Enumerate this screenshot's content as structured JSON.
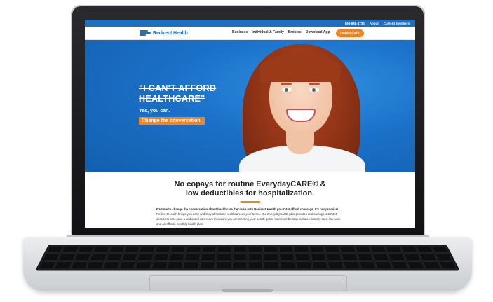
{
  "topbar": {
    "phone": "866-698-4734",
    "about": "About",
    "current_members": "Current Members"
  },
  "nav": {
    "logo_text": "Redirect Health",
    "items": [
      "Business",
      "Individual & Family",
      "Brokers",
      "Download App"
    ],
    "cta": "I Need Care"
  },
  "hero": {
    "headline_line1": "\"I CAN'T AFFORD",
    "headline_line2": "HEALTHCARE\"",
    "subline": "Yes, you can.",
    "cta": "Change the conversation."
  },
  "content": {
    "title_line1": "No copays for routine EverydayCARE® &",
    "title_line2": "low deductibles for hospitalization.",
    "intro_bold": "It's time to change the conversation about healthcare, because with Redirect Health you CAN afford coverage. It's our promise!",
    "intro_text": " Redirect Health brings you easy and truly affordable healthcare on your terms. Our EverydayCARE plan provides real savings, 24/7/365 access to care, and a dedicated care team to ensure you are meeting your health goals. Your membership includes primary care, lab work and an official, monthly health plan."
  },
  "colors": {
    "brand_blue": "#1d6fbf",
    "accent_orange": "#f58220"
  }
}
